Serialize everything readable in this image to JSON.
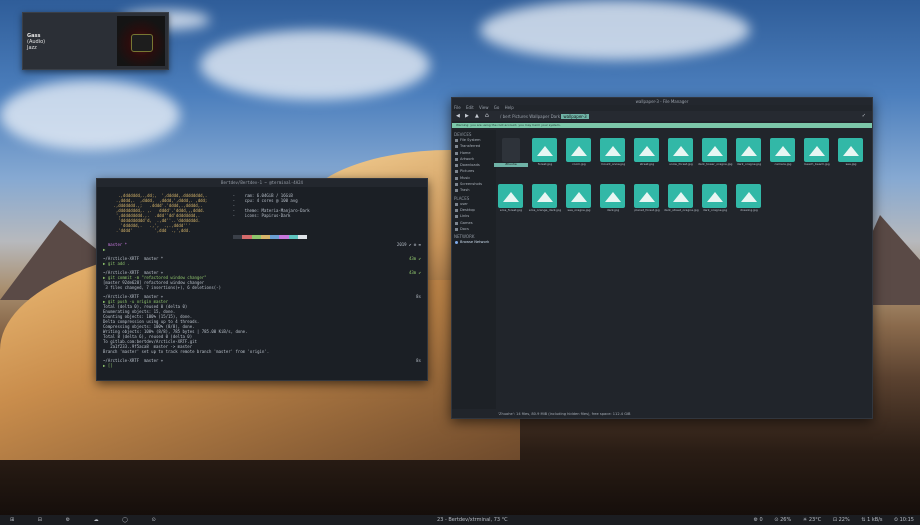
{
  "notification": {
    "title": "Gass",
    "lines": [
      "(Audio)",
      "Jazz"
    ]
  },
  "terminal": {
    "title": "Bertdev/Bertdev-1 ~ @terminal-4A24",
    "neofetch_art": [
      "   .,ddddddd,.,dd;,  ',ddddd,.dddddddd,.",
      "  .,dddd,.  ,dddd,  ,dddd,',dddd,. ,ddd;",
      " .,ddddddd.,;   .dddd'.'dddd,.,ddddd,.",
      "  ,ddddddddd,. ,.   dddd'.'dddd,,,dddd.",
      "  ',ddddddddd.,.  .ddd''dd'dddddddd,.",
      "   'dddddddddd'd,  .,dd''..'dddddddd.",
      "    'dddddd,.   .,',  .,.,dddd'''",
      "  .'dddd'         ',ddd  .,',ddd."
    ],
    "sysinfo": [
      "    -    ram: 6.04GiB / 16GiB",
      "    -    cpu: 4 cores @ 100 avg",
      "    -    ",
      "    -    theme: Materia-Manjaro-Dark",
      "    -    icons: Papirus-Dark"
    ],
    "lines": [
      "  master *",
      "▶ ",
      "~/Arcticle-XRTF  master *",
      "▶ git add .",
      "~/Arcticle-XRTF  master +",
      "▶ git commit -m \"refactored window changer\"",
      "[master 92de628] refactored window changer",
      " 3 files changed, 7 insertions(+), 6 deletions(-)",
      "~/Arcticle-XRTF  master +",
      "▶ git push -u origin master",
      "Total (delta 0), reused 0 (delta 0)",
      "Enumerating objects: 15, done.",
      "Counting objects: 100% (15/15), done.",
      "Delta compression using up to 4 threads.",
      "Compressing objects: 100% (8/8), done.",
      "Writing objects: 100% (8/8), 785 bytes | 785.00 KiB/s, done.",
      "Total 8 (delta 6), reused 0 (delta 0)",
      "To gitlab.com:bertdev/Arcticle-XRTF.git",
      "   2a1f233..9f5aca8  master -> master",
      "Branch 'master' set up to track remote branch 'master' from 'origin'.",
      "~/Arcticle-XRTF  master +",
      "▶ []"
    ],
    "right_times": [
      "2019 ✔ ⚙ ≡",
      "43m ✔",
      "43m ✔",
      "8s",
      "8s"
    ]
  },
  "file_manager": {
    "title": "wallpaper-3 - File Manager",
    "menu": [
      "File",
      "Edit",
      "View",
      "Go",
      "Help"
    ],
    "location": [
      "/",
      "bert",
      "Pictures",
      "Wallpaper",
      "Dark"
    ],
    "location_active": "wallpaper-3",
    "notice": "Warning: you are using the root account, you may harm your system.",
    "sidebar": {
      "devices_header": "DEVICES",
      "devices": [
        "File System",
        "Transferred",
        "Home",
        "Artwork",
        "Downloads",
        "Pictures",
        "Music",
        "Screenshots",
        "Trash"
      ],
      "places_header": "PLACES",
      "places": [
        "user",
        "Desktop",
        "Links",
        "Games",
        "Docs"
      ],
      "network_header": "NETWORK",
      "network": [
        "Browse Network"
      ]
    },
    "files": [
      "Zhuohe",
      "forest.jpg",
      "room.jpg",
      "mount_snow.jpg",
      "street.jpg",
      "snow_forest.jpg",
      "dark_tower_oragne.jpg",
      "dark_oragne.jpg",
      "camera.jpg",
      "beach_beach.jpg",
      "sea.jpg",
      "eros_forest.jpg",
      "eros_orange_dark.jpg",
      "sea_oragne.jpg",
      "dark.jpg",
      "planet_forest.jpg",
      "dark_street_oragne.jpg",
      "dark_oragne.jpg",
      "drawing.jpg"
    ],
    "status": "'Zhuohe': 14 files, 80.9 MiB (including hidden files), free space: 112.4 GiB"
  },
  "taskbar": {
    "left_icons": [
      "⊞",
      "⊟",
      "⚙",
      "☁",
      "◯",
      "⊙"
    ],
    "center": "23 - Bertdev/xtrminal, 73 °C",
    "right": [
      "⚙ 0",
      "⊙ 26%",
      "☀ 23°C",
      "⊡ 22%",
      "⇅ 1 kB/s",
      "⏲ 10:15"
    ]
  },
  "colors": {
    "accent": "#32b8a7",
    "notice": "#7cc7a9",
    "panel": "#21252b"
  }
}
